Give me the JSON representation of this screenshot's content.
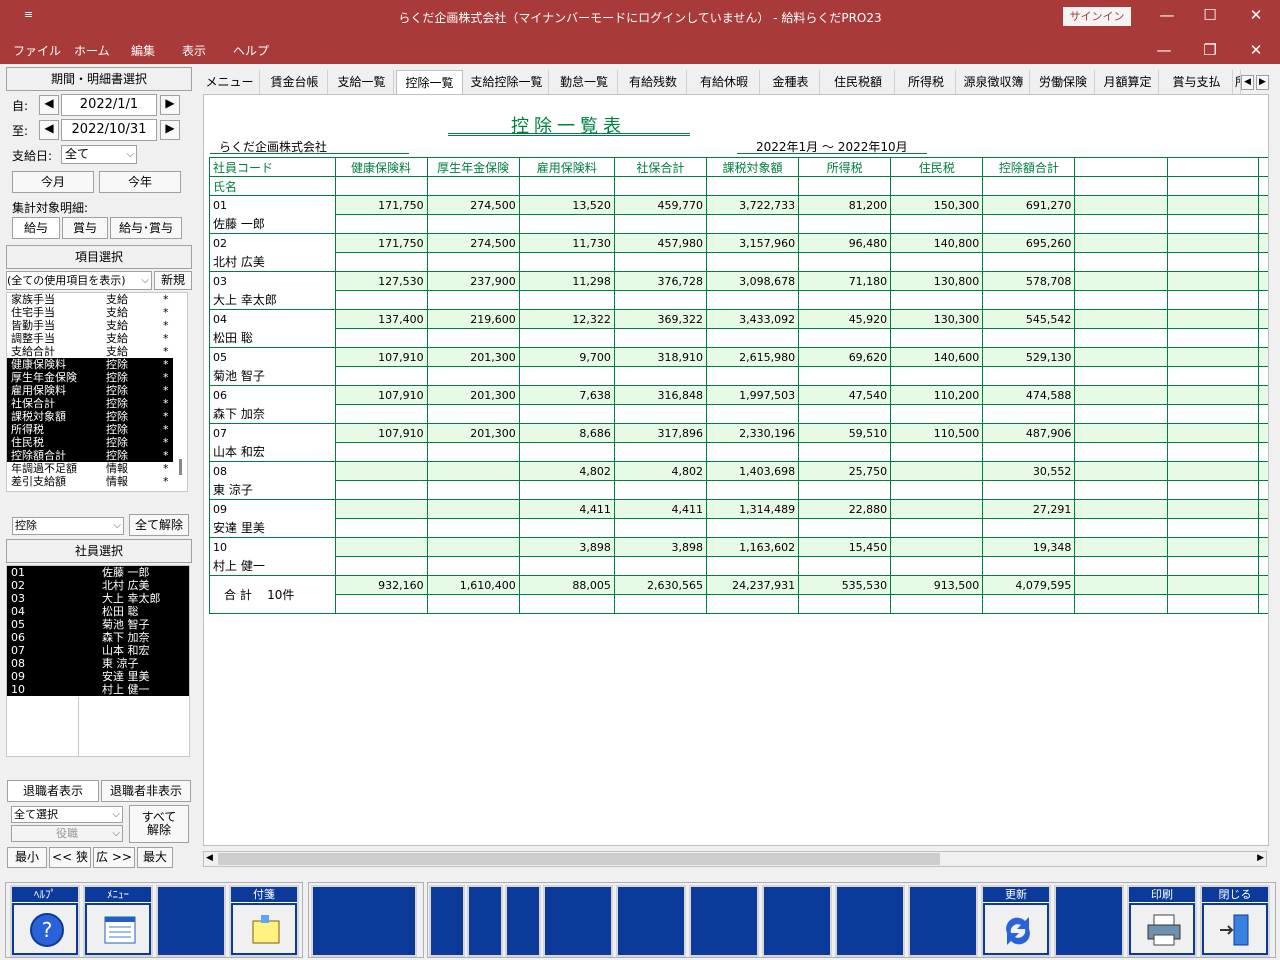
{
  "titlebar": {
    "title": "らくだ企画株式会社（マイナンバーモードにログインしていません） -  給料らくだPRO23",
    "sys_icon": "≡",
    "signin": "サインイン",
    "minimize": "—",
    "maximize": "☐",
    "close": "✕"
  },
  "menubar": {
    "items": [
      "ファイル",
      "ホーム",
      "編集",
      "表示",
      "ヘルプ"
    ],
    "minimize": "—",
    "restore": "❐",
    "close": "✕"
  },
  "left": {
    "period_header": "期間・明細書選択",
    "from_label": "自:",
    "from_date": "2022/1/1",
    "to_label": "至:",
    "to_date": "2022/10/31",
    "payday_label": "支給日:",
    "payday_value": "全て",
    "this_month": "今月",
    "this_year": "今年",
    "target_label": "集計対象明細:",
    "target_buttons": [
      "給与",
      "賞与",
      "給与･賞与"
    ],
    "item_header": "項目選択",
    "item_filter": "(全ての使用項目を表示)",
    "new_button": "新規",
    "items": [
      {
        "name": "家族手当",
        "type": "支給",
        "mark": "*",
        "sel": false
      },
      {
        "name": "住宅手当",
        "type": "支給",
        "mark": "*",
        "sel": false
      },
      {
        "name": "皆勤手当",
        "type": "支給",
        "mark": "*",
        "sel": false
      },
      {
        "name": "調整手当",
        "type": "支給",
        "mark": "*",
        "sel": false
      },
      {
        "name": "支給合計",
        "type": "支給",
        "mark": "*",
        "sel": false
      },
      {
        "name": "健康保険料",
        "type": "控除",
        "mark": "*",
        "sel": true
      },
      {
        "name": "厚生年金保険",
        "type": "控除",
        "mark": "*",
        "sel": true
      },
      {
        "name": "雇用保険料",
        "type": "控除",
        "mark": "*",
        "sel": true
      },
      {
        "name": "社保合計",
        "type": "控除",
        "mark": "*",
        "sel": true
      },
      {
        "name": "課税対象額",
        "type": "控除",
        "mark": "*",
        "sel": true
      },
      {
        "name": "所得税",
        "type": "控除",
        "mark": "*",
        "sel": true
      },
      {
        "name": "住民税",
        "type": "控除",
        "mark": "*",
        "sel": true
      },
      {
        "name": "控除額合計",
        "type": "控除",
        "mark": "*",
        "sel": true
      },
      {
        "name": "年調過不足額",
        "type": "情報",
        "mark": "*",
        "sel": false
      },
      {
        "name": "差引支給額",
        "type": "情報",
        "mark": "*",
        "sel": false
      }
    ],
    "category_value": "控除",
    "clear_all": "全て解除",
    "employee_header": "社員選択",
    "employees": [
      {
        "code": "01",
        "name": "佐藤 一郎"
      },
      {
        "code": "02",
        "name": "北村 広美"
      },
      {
        "code": "03",
        "name": "大上 幸太郎"
      },
      {
        "code": "04",
        "name": "松田 聡"
      },
      {
        "code": "05",
        "name": "菊池 智子"
      },
      {
        "code": "06",
        "name": "森下 加奈"
      },
      {
        "code": "07",
        "name": "山本 和宏"
      },
      {
        "code": "08",
        "name": "東 涼子"
      },
      {
        "code": "09",
        "name": "安達 里美"
      },
      {
        "code": "10",
        "name": "村上 健一"
      }
    ],
    "retired_show": "退職者表示",
    "retired_hide": "退職者非表示",
    "select_all": "全て選択",
    "position": "役職",
    "release_all": "すべて\n解除",
    "zoom": [
      "最小",
      "<< 狭",
      "広 >>",
      "最大"
    ]
  },
  "tabs": [
    "メニュー",
    "賃金台帳",
    "支給一覧",
    "控除一覧",
    "支給控除一覧",
    "勤怠一覧",
    "有給残数",
    "有給休暇",
    "金種表",
    "住民税額",
    "所得税",
    "源泉徴収簿",
    "労働保険",
    "月額算定",
    "賞与支払",
    "所"
  ],
  "active_tab": 3,
  "report": {
    "title": "控除一覧表",
    "company": "らくだ企画株式会社",
    "period": "2022年1月 ～ 2022年10月",
    "col_code": "社員コード",
    "col_name": "氏名",
    "columns": [
      "健康保険料",
      "厚生年金保険",
      "雇用保険料",
      "社保合計",
      "課税対象額",
      "所得税",
      "住民税",
      "控除額合計"
    ],
    "rows": [
      {
        "code": "01",
        "name": "佐藤 一郎",
        "values": [
          "171,750",
          "274,500",
          "13,520",
          "459,770",
          "3,722,733",
          "81,200",
          "150,300",
          "691,270"
        ]
      },
      {
        "code": "02",
        "name": "北村 広美",
        "values": [
          "171,750",
          "274,500",
          "11,730",
          "457,980",
          "3,157,960",
          "96,480",
          "140,800",
          "695,260"
        ]
      },
      {
        "code": "03",
        "name": "大上 幸太郎",
        "values": [
          "127,530",
          "237,900",
          "11,298",
          "376,728",
          "3,098,678",
          "71,180",
          "130,800",
          "578,708"
        ]
      },
      {
        "code": "04",
        "name": "松田 聡",
        "values": [
          "137,400",
          "219,600",
          "12,322",
          "369,322",
          "3,433,092",
          "45,920",
          "130,300",
          "545,542"
        ]
      },
      {
        "code": "05",
        "name": "菊池 智子",
        "values": [
          "107,910",
          "201,300",
          "9,700",
          "318,910",
          "2,615,980",
          "69,620",
          "140,600",
          "529,130"
        ]
      },
      {
        "code": "06",
        "name": "森下 加奈",
        "values": [
          "107,910",
          "201,300",
          "7,638",
          "316,848",
          "1,997,503",
          "47,540",
          "110,200",
          "474,588"
        ]
      },
      {
        "code": "07",
        "name": "山本 和宏",
        "values": [
          "107,910",
          "201,300",
          "8,686",
          "317,896",
          "2,330,196",
          "59,510",
          "110,500",
          "487,906"
        ]
      },
      {
        "code": "08",
        "name": "東 涼子",
        "values": [
          "",
          "",
          "4,802",
          "4,802",
          "1,403,698",
          "25,750",
          "",
          "30,552"
        ]
      },
      {
        "code": "09",
        "name": "安達 里美",
        "values": [
          "",
          "",
          "4,411",
          "4,411",
          "1,314,489",
          "22,880",
          "",
          "27,291"
        ]
      },
      {
        "code": "10",
        "name": "村上 健一",
        "values": [
          "",
          "",
          "3,898",
          "3,898",
          "1,163,602",
          "15,450",
          "",
          "19,348"
        ]
      }
    ],
    "total_label": "合 計",
    "total_count": "10件",
    "totals": [
      "932,160",
      "1,610,400",
      "88,005",
      "2,630,565",
      "24,237,931",
      "535,530",
      "913,500",
      "4,079,595"
    ]
  },
  "fkeys": [
    {
      "label": "ﾍﾙﾌﾟ",
      "icon": "help-icon"
    },
    {
      "label": "ﾒﾆｭｰ",
      "icon": "menu-icon"
    },
    {
      "label": "",
      "icon": ""
    },
    {
      "label": "付箋",
      "icon": "sticky-note-icon"
    },
    {
      "label": "",
      "icon": ""
    },
    {
      "label": "",
      "icon": ""
    },
    {
      "label": "",
      "icon": ""
    },
    {
      "label": "",
      "icon": ""
    },
    {
      "label": "",
      "icon": ""
    },
    {
      "label": "",
      "icon": ""
    },
    {
      "label": "",
      "icon": ""
    },
    {
      "label": "",
      "icon": ""
    },
    {
      "label": "",
      "icon": ""
    },
    {
      "label": "",
      "icon": ""
    },
    {
      "label": "更新",
      "icon": "refresh-icon"
    },
    {
      "label": "",
      "icon": ""
    },
    {
      "label": "印刷",
      "icon": "printer-icon"
    },
    {
      "label": "閉じる",
      "icon": "exit-icon"
    }
  ],
  "colors": {
    "title_bg": "#a83a3a",
    "grid": "#008040",
    "row_fill": "#e6fae6",
    "fkey_bg": "#0b3a9a"
  }
}
